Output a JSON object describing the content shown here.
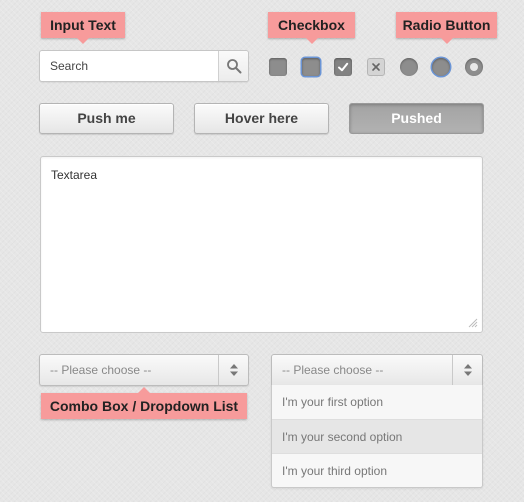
{
  "labels": {
    "input_text": "Input Text",
    "checkbox": "Checkbox",
    "radio_button": "Radio Button",
    "combo_box": "Combo Box / Dropdown List"
  },
  "search": {
    "placeholder": "Search",
    "icon": "search-icon"
  },
  "checkboxes": [
    {
      "state": "unchecked"
    },
    {
      "state": "hover"
    },
    {
      "state": "checked",
      "icon": "check-icon"
    },
    {
      "state": "disabled",
      "icon": "close-icon"
    }
  ],
  "radios": [
    {
      "state": "unselected"
    },
    {
      "state": "hover"
    },
    {
      "state": "selected"
    }
  ],
  "buttons": {
    "push": "Push me",
    "hover": "Hover here",
    "pushed": "Pushed"
  },
  "textarea": {
    "value": "Textarea"
  },
  "combo_left": {
    "value": "-- Please choose --",
    "icon": "chevron-updown-icon"
  },
  "combo_right": {
    "value": "-- Please choose --",
    "icon": "chevron-updown-icon",
    "options": [
      "I'm your first option",
      "I'm your second option",
      "I'm your third option"
    ]
  },
  "colors": {
    "tag": "#f79b9b",
    "focus_ring": "#6b95d6",
    "pushed_button": "#a8a8a8"
  }
}
